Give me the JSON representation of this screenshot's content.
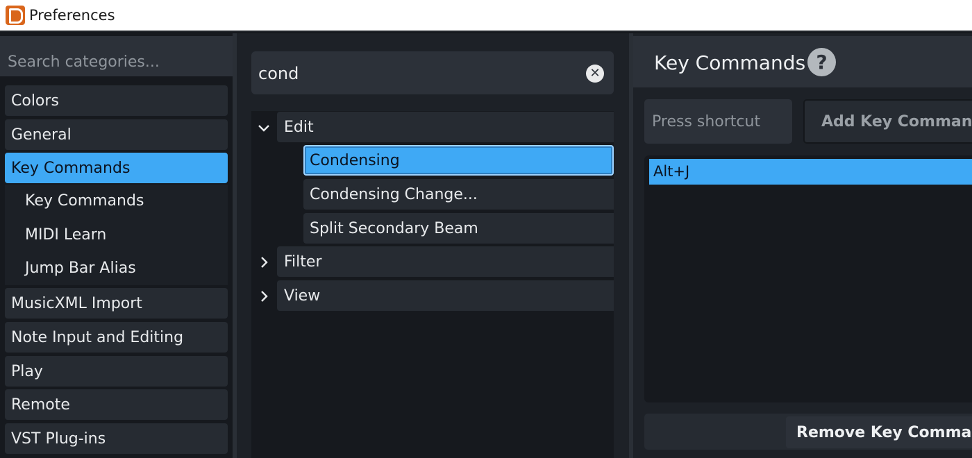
{
  "window": {
    "title": "Preferences",
    "app_icon": "dorico-app-icon"
  },
  "categories": {
    "search_placeholder": "Search categories...",
    "items": [
      {
        "label": "Colors"
      },
      {
        "label": "General"
      },
      {
        "label": "Key Commands",
        "active": true
      },
      {
        "label": "MusicXML Import"
      },
      {
        "label": "Note Input and Editing"
      },
      {
        "label": "Play"
      },
      {
        "label": "Remote"
      },
      {
        "label": "VST Plug-ins"
      }
    ],
    "subitems": [
      {
        "label": "Key Commands"
      },
      {
        "label": "MIDI Learn"
      },
      {
        "label": "Jump Bar Alias"
      }
    ]
  },
  "commands": {
    "filter_value": "cond",
    "clear_icon": "clear-icon",
    "groups": [
      {
        "label": "Edit",
        "expanded": true,
        "commands": [
          {
            "label": "Condensing",
            "selected": true
          },
          {
            "label": "Condensing Change..."
          },
          {
            "label": "Split Secondary Beam"
          }
        ]
      },
      {
        "label": "Filter",
        "expanded": false
      },
      {
        "label": "View",
        "expanded": false
      }
    ]
  },
  "key_commands": {
    "title": "Key Commands",
    "help_glyph": "?",
    "shortcut_placeholder": "Press shortcut",
    "add_label": "Add Key Command",
    "shortcuts": [
      "Alt+J"
    ],
    "remove_label": "Remove Key Command"
  },
  "colors": {
    "accent": "#3fa9f5",
    "panel": "#262b32",
    "background": "#16191e"
  }
}
